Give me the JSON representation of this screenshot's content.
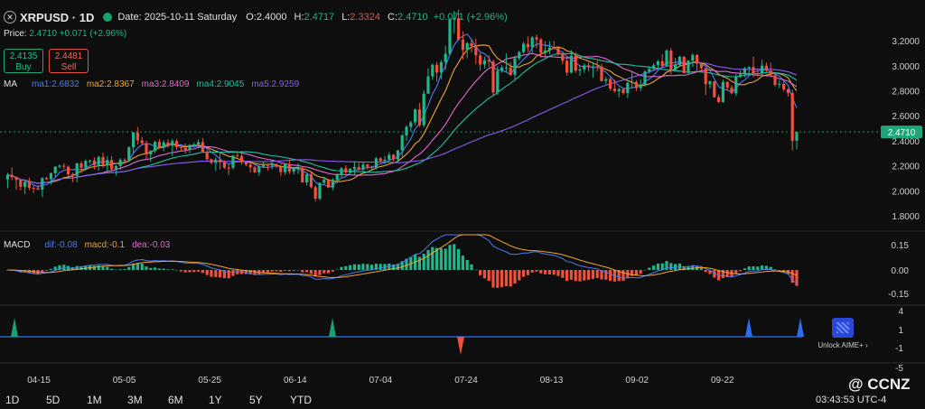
{
  "header": {
    "symbol": "XRPUSD · 1D",
    "date_label": "Date: 2025-10-11 Saturday",
    "open_label": "O:",
    "open": "2.4000",
    "high_label": "H:",
    "high": "2.4717",
    "low_label": "L:",
    "low": "2.3324",
    "close_label": "C:",
    "close": "2.4710",
    "change": "+0.071 (+2.96%)"
  },
  "price_row": {
    "label": "Price:",
    "value": "2.4710",
    "change": "+0.071 (+2.96%)"
  },
  "trade": {
    "buy_price": "2.4135",
    "buy_label": "Buy",
    "sell_price": "2.4481",
    "sell_label": "Sell"
  },
  "ma_legend": {
    "title": "MA",
    "items": [
      "ma1:2.6832",
      "ma2:2.8367",
      "ma3:2.8409",
      "ma4:2.9045",
      "ma5:2.9259"
    ]
  },
  "macd_legend": {
    "title": "MACD",
    "dif": "dif:-0.08",
    "macd": "macd:-0.1",
    "dea": "dea:-0.03"
  },
  "timeframes": [
    "1D",
    "5D",
    "1M",
    "3M",
    "6M",
    "1Y",
    "5Y",
    "YTD"
  ],
  "clock": "03:43:53 UTC-4",
  "watermark": "@ CCNZ",
  "aime_label": "Unlock AIME+ ›",
  "colors": {
    "up": "#22b58a",
    "down": "#f0503c",
    "ma1": "#4b7bf5",
    "ma2": "#f2a531",
    "ma3": "#e36ad1",
    "ma4": "#1fbfa0",
    "ma5": "#8a5cf0",
    "signal_up": "#1a9f7a",
    "signal_down": "#2f6df0"
  },
  "chart_data": {
    "type": "candlestick",
    "x_ticks": [
      "04-15",
      "05-05",
      "05-25",
      "06-14",
      "07-04",
      "07-24",
      "08-13",
      "09-02",
      "09-22"
    ],
    "y_ticks": [
      "3.2000",
      "3.0000",
      "2.8000",
      "2.6000",
      "2.4000",
      "2.2000",
      "2.0000",
      "1.8000"
    ],
    "ylim": [
      1.72,
      3.44
    ],
    "last_price_tag": "2.4710",
    "candles": [
      [
        2.09,
        2.143,
        2.02,
        2.127
      ],
      [
        2.127,
        2.186,
        2.084,
        2.108
      ],
      [
        2.108,
        2.11,
        2.009,
        2.087
      ],
      [
        2.087,
        2.089,
        2.002,
        2.031
      ],
      [
        2.031,
        2.081,
        1.973,
        2.072
      ],
      [
        2.072,
        2.105,
        2.003,
        2.023
      ],
      [
        2.023,
        2.041,
        1.981,
        2.02
      ],
      [
        2.02,
        2.047,
        2.006,
        2.008
      ],
      [
        2.008,
        2.106,
        1.949,
        2.102
      ],
      [
        2.102,
        2.112,
        2.087,
        2.092
      ],
      [
        2.092,
        2.146,
        2.05,
        2.14
      ],
      [
        2.14,
        2.198,
        2.112,
        2.192
      ],
      [
        2.192,
        2.209,
        2.18,
        2.201
      ],
      [
        2.201,
        2.219,
        2.173,
        2.192
      ],
      [
        2.192,
        2.202,
        2.113,
        2.132
      ],
      [
        2.132,
        2.146,
        2.068,
        2.119
      ],
      [
        2.119,
        2.225,
        2.067,
        2.219
      ],
      [
        2.219,
        2.238,
        2.143,
        2.185
      ],
      [
        2.185,
        2.25,
        2.163,
        2.239
      ],
      [
        2.239,
        2.249,
        2.216,
        2.242
      ],
      [
        2.242,
        2.268,
        2.171,
        2.205
      ],
      [
        2.205,
        2.281,
        2.161,
        2.27
      ],
      [
        2.27,
        2.304,
        2.185,
        2.206
      ],
      [
        2.206,
        2.277,
        2.16,
        2.246
      ],
      [
        2.246,
        2.278,
        2.152,
        2.173
      ],
      [
        2.173,
        2.206,
        2.122,
        2.198
      ],
      [
        2.198,
        2.26,
        2.167,
        2.247
      ],
      [
        2.247,
        2.26,
        2.22,
        2.244
      ],
      [
        2.244,
        2.355,
        2.23,
        2.348
      ],
      [
        2.348,
        2.471,
        2.293,
        2.466
      ],
      [
        2.466,
        2.51,
        2.371,
        2.403
      ],
      [
        2.403,
        2.431,
        2.364,
        2.38
      ],
      [
        2.38,
        2.401,
        2.249,
        2.29
      ],
      [
        2.29,
        2.329,
        2.231,
        2.318
      ],
      [
        2.318,
        2.4,
        2.302,
        2.391
      ],
      [
        2.391,
        2.413,
        2.336,
        2.345
      ],
      [
        2.345,
        2.404,
        2.316,
        2.386
      ],
      [
        2.386,
        2.411,
        2.345,
        2.36
      ],
      [
        2.36,
        2.414,
        2.277,
        2.398
      ],
      [
        2.398,
        2.414,
        2.324,
        2.349
      ],
      [
        2.349,
        2.361,
        2.313,
        2.343
      ],
      [
        2.343,
        2.378,
        2.297,
        2.327
      ],
      [
        2.327,
        2.373,
        2.301,
        2.367
      ],
      [
        2.367,
        2.388,
        2.352,
        2.37
      ],
      [
        2.37,
        2.412,
        2.349,
        2.389
      ],
      [
        2.389,
        2.422,
        2.303,
        2.313
      ],
      [
        2.313,
        2.327,
        2.241,
        2.252
      ],
      [
        2.252,
        2.257,
        2.211,
        2.223
      ],
      [
        2.223,
        2.266,
        2.158,
        2.249
      ],
      [
        2.249,
        2.313,
        2.17,
        2.228
      ],
      [
        2.228,
        2.243,
        2.175,
        2.185
      ],
      [
        2.185,
        2.216,
        2.126,
        2.184
      ],
      [
        2.184,
        2.287,
        2.17,
        2.282
      ],
      [
        2.282,
        2.309,
        2.268,
        2.278
      ],
      [
        2.278,
        2.32,
        2.207,
        2.228
      ],
      [
        2.228,
        2.233,
        2.196,
        2.209
      ],
      [
        2.209,
        2.222,
        2.145,
        2.187
      ],
      [
        2.187,
        2.199,
        2.142,
        2.147
      ],
      [
        2.147,
        2.203,
        2.121,
        2.194
      ],
      [
        2.194,
        2.234,
        2.18,
        2.206
      ],
      [
        2.206,
        2.214,
        2.16,
        2.2
      ],
      [
        2.2,
        2.241,
        2.171,
        2.212
      ],
      [
        2.212,
        2.22,
        2.182,
        2.193
      ],
      [
        2.193,
        2.213,
        2.117,
        2.149
      ],
      [
        2.149,
        2.216,
        2.127,
        2.212
      ],
      [
        2.212,
        2.25,
        2.134,
        2.153
      ],
      [
        2.153,
        2.18,
        2.131,
        2.177
      ],
      [
        2.177,
        2.219,
        2.134,
        2.183
      ],
      [
        2.183,
        2.192,
        2.065,
        2.066
      ],
      [
        2.066,
        2.143,
        2.041,
        2.131
      ],
      [
        2.131,
        2.156,
        2.018,
        2.029
      ],
      [
        2.029,
        2.043,
        1.913,
        1.937
      ],
      [
        1.937,
        2.067,
        1.922,
        2.063
      ],
      [
        2.063,
        2.112,
        2.048,
        2.09
      ],
      [
        2.09,
        2.096,
        2.022,
        2.026
      ],
      [
        2.026,
        2.101,
        2.005,
        2.087
      ],
      [
        2.087,
        2.142,
        2.059,
        2.125
      ],
      [
        2.125,
        2.19,
        2.103,
        2.18
      ],
      [
        2.18,
        2.204,
        2.131,
        2.147
      ],
      [
        2.147,
        2.182,
        2.14,
        2.174
      ],
      [
        2.174,
        2.236,
        2.125,
        2.19
      ],
      [
        2.19,
        2.222,
        2.163,
        2.169
      ],
      [
        2.169,
        2.233,
        2.137,
        2.209
      ],
      [
        2.209,
        2.217,
        2.169,
        2.191
      ],
      [
        2.191,
        2.201,
        2.168,
        2.182
      ],
      [
        2.182,
        2.269,
        2.17,
        2.259
      ],
      [
        2.259,
        2.269,
        2.228,
        2.238
      ],
      [
        2.238,
        2.278,
        2.215,
        2.249
      ],
      [
        2.249,
        2.309,
        2.237,
        2.287
      ],
      [
        2.287,
        2.295,
        2.233,
        2.251
      ],
      [
        2.251,
        2.328,
        2.226,
        2.323
      ],
      [
        2.323,
        2.454,
        2.274,
        2.443
      ],
      [
        2.443,
        2.526,
        2.398,
        2.511
      ],
      [
        2.511,
        2.56,
        2.474,
        2.548
      ],
      [
        2.548,
        2.657,
        2.523,
        2.651
      ],
      [
        2.651,
        2.703,
        2.51,
        2.525
      ],
      [
        2.525,
        2.805,
        2.508,
        2.777
      ],
      [
        2.777,
        2.98,
        2.777,
        2.915
      ],
      [
        2.915,
        3.019,
        2.889,
        3.008
      ],
      [
        3.008,
        3.032,
        2.872,
        2.946
      ],
      [
        2.946,
        3.046,
        2.893,
        3.029
      ],
      [
        3.029,
        3.16,
        2.967,
        3.096
      ],
      [
        3.096,
        3.381,
        3.088,
        3.369
      ],
      [
        3.369,
        3.439,
        3.261,
        3.381
      ],
      [
        3.381,
        3.45,
        3.2,
        3.21
      ],
      [
        3.21,
        3.276,
        3.051,
        3.127
      ],
      [
        3.127,
        3.191,
        3.06,
        3.181
      ],
      [
        3.181,
        3.206,
        3.109,
        3.158
      ],
      [
        3.158,
        3.217,
        3.013,
        3.084
      ],
      [
        3.084,
        3.107,
        2.962,
        3.011
      ],
      [
        3.011,
        3.074,
        2.978,
        3.045
      ],
      [
        3.045,
        3.085,
        2.994,
        3.034
      ],
      [
        3.034,
        3.05,
        2.76,
        2.787
      ],
      [
        2.787,
        2.998,
        2.766,
        2.96
      ],
      [
        2.96,
        3.004,
        2.944,
        2.986
      ],
      [
        2.986,
        3.1,
        2.945,
        2.987
      ],
      [
        2.987,
        3.03,
        2.918,
        2.927
      ],
      [
        2.927,
        3.082,
        2.88,
        3.06
      ],
      [
        3.06,
        3.12,
        3.041,
        3.11
      ],
      [
        3.11,
        3.193,
        3.096,
        3.176
      ],
      [
        3.176,
        3.234,
        3.109,
        3.148
      ],
      [
        3.148,
        3.239,
        3.103,
        3.228
      ],
      [
        3.228,
        3.25,
        3.141,
        3.211
      ],
      [
        3.211,
        3.223,
        3.064,
        3.104
      ],
      [
        3.104,
        3.198,
        3.067,
        3.123
      ],
      [
        3.123,
        3.197,
        3.091,
        3.146
      ],
      [
        3.146,
        3.199,
        3.127,
        3.143
      ],
      [
        3.143,
        3.161,
        3.08,
        3.095
      ],
      [
        3.095,
        3.101,
        3.012,
        3.04
      ],
      [
        3.04,
        3.072,
        2.919,
        2.945
      ],
      [
        2.945,
        3.125,
        2.94,
        3.08
      ],
      [
        3.08,
        3.107,
        2.942,
        2.961
      ],
      [
        2.961,
        3.004,
        2.92,
        2.971
      ],
      [
        2.971,
        3.019,
        2.943,
        3.003
      ],
      [
        3.003,
        3.025,
        2.954,
        2.988
      ],
      [
        2.988,
        3.023,
        2.905,
        2.995
      ],
      [
        2.995,
        3.043,
        2.956,
        2.994
      ],
      [
        2.994,
        3.016,
        2.874,
        2.878
      ],
      [
        2.878,
        2.912,
        2.854,
        2.893
      ],
      [
        2.893,
        2.909,
        2.8,
        2.817
      ],
      [
        2.817,
        2.889,
        2.788,
        2.797
      ],
      [
        2.797,
        2.827,
        2.748,
        2.812
      ],
      [
        2.812,
        2.825,
        2.77,
        2.782
      ],
      [
        2.782,
        2.874,
        2.741,
        2.863
      ],
      [
        2.863,
        2.947,
        2.819,
        2.871
      ],
      [
        2.871,
        2.885,
        2.798,
        2.822
      ],
      [
        2.822,
        2.892,
        2.796,
        2.851
      ],
      [
        2.851,
        2.966,
        2.832,
        2.954
      ],
      [
        2.954,
        2.998,
        2.94,
        2.975
      ],
      [
        2.975,
        3.02,
        2.961,
        3.004
      ],
      [
        3.004,
        3.047,
        2.973,
        3.036
      ],
      [
        3.036,
        3.093,
        2.994,
        2.999
      ],
      [
        2.999,
        3.133,
        2.994,
        3.122
      ],
      [
        3.122,
        3.142,
        2.931,
        2.967
      ],
      [
        2.967,
        3.062,
        2.956,
        3.007
      ],
      [
        3.007,
        3.079,
        2.992,
        3.072
      ],
      [
        3.072,
        3.077,
        2.937,
        2.943
      ],
      [
        2.943,
        3.048,
        2.93,
        3.041
      ],
      [
        3.041,
        3.101,
        2.991,
        3.086
      ],
      [
        3.086,
        3.094,
        2.954,
        3.018
      ],
      [
        3.018,
        3.022,
        2.963,
        2.981
      ],
      [
        2.981,
        2.985,
        2.766,
        2.853
      ],
      [
        2.853,
        2.882,
        2.819,
        2.875
      ],
      [
        2.875,
        2.878,
        2.743,
        2.749
      ],
      [
        2.749,
        2.77,
        2.702,
        2.711
      ],
      [
        2.711,
        2.89,
        2.703,
        2.871
      ],
      [
        2.871,
        2.875,
        2.801,
        2.825
      ],
      [
        2.825,
        2.846,
        2.772,
        2.78
      ],
      [
        2.78,
        2.935,
        2.758,
        2.916
      ],
      [
        2.916,
        2.963,
        2.903,
        2.932
      ],
      [
        2.932,
        2.991,
        2.907,
        2.98
      ],
      [
        2.98,
        2.994,
        2.933,
        2.991
      ],
      [
        2.991,
        3.074,
        2.909,
        2.941
      ],
      [
        2.941,
        2.969,
        2.914,
        2.938
      ],
      [
        2.938,
        3.048,
        2.913,
        3.001
      ],
      [
        3.001,
        3.028,
        2.95,
        2.961
      ],
      [
        2.961,
        3.026,
        2.907,
        2.925
      ],
      [
        2.925,
        2.941,
        2.832,
        2.848
      ],
      [
        2.848,
        2.889,
        2.822,
        2.855
      ],
      [
        2.855,
        2.879,
        2.795,
        2.812
      ],
      [
        2.812,
        2.82,
        2.754,
        2.782
      ],
      [
        2.782,
        2.809,
        2.322,
        2.4
      ],
      [
        2.4,
        2.472,
        2.332,
        2.471
      ]
    ]
  }
}
